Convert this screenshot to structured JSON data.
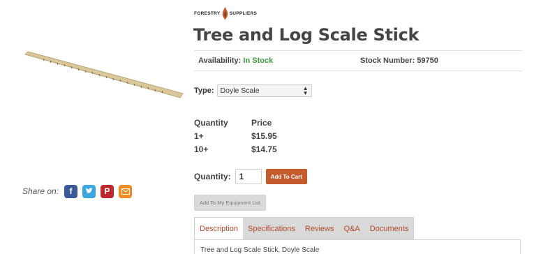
{
  "logo": {
    "left": "FORESTRY",
    "right": "SUPPLIERS"
  },
  "product": {
    "title": "Tree and Log Scale Stick",
    "availability_label": "Availability:",
    "availability_value": "In Stock",
    "stock_label": "Stock Number:",
    "stock_value": "59750",
    "type_label": "Type:",
    "type_value": "Doyle Scale"
  },
  "pricing": {
    "headers": [
      "Quantity",
      "Price"
    ],
    "rows": [
      {
        "qty": "1+",
        "price": "$15.95"
      },
      {
        "qty": "10+",
        "price": "$14.75"
      }
    ]
  },
  "cart": {
    "quantity_label": "Quantity:",
    "quantity_value": "1",
    "add_to_cart": "Add To Cart",
    "add_to_list": "Add To My Equipment List"
  },
  "share": {
    "label": "Share on:",
    "icons": [
      "facebook-icon",
      "twitter-icon",
      "pinterest-icon",
      "email-icon"
    ],
    "colors": {
      "facebook": "#3b5998",
      "twitter": "#3aa6e0",
      "pinterest": "#c0272d",
      "email": "#f08a24"
    }
  },
  "tabs": {
    "items": [
      "Description",
      "Specifications",
      "Reviews",
      "Q&A",
      "Documents"
    ],
    "active": "Description",
    "content": "Tree and Log Scale Stick, Doyle Scale"
  },
  "colors": {
    "accent": "#c55a2c",
    "in_stock": "#3a9d3a",
    "tab_text": "#b24a2a"
  }
}
